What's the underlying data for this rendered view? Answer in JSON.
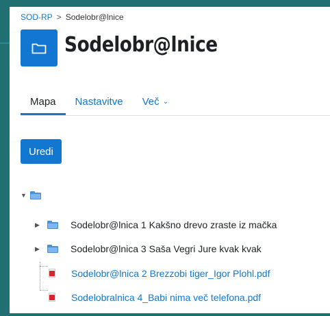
{
  "breadcrumb": {
    "root": "SOD-RP",
    "separator": ">",
    "current": "Sodelobr@lnice"
  },
  "header": {
    "title": "Sodelobr@lnice",
    "icon": "folder-icon"
  },
  "tabs": [
    {
      "label": "Mapa",
      "active": true
    },
    {
      "label": "Nastavitve",
      "active": false
    },
    {
      "label": "Več",
      "active": false,
      "dropdown": true
    }
  ],
  "actions": {
    "edit_label": "Uredi"
  },
  "tree": {
    "root": {
      "icon": "folder-icon",
      "expanded": true
    },
    "items": [
      {
        "type": "folder",
        "icon": "folder-icon",
        "expanded": false,
        "label": "Sodelobr@lnica 1 Kakšno drevo zraste iz mačka"
      },
      {
        "type": "folder",
        "icon": "folder-icon",
        "expanded": false,
        "label": "Sodelobr@lnica 3 Saša Vegri Jure kvak kvak"
      },
      {
        "type": "file",
        "icon": "pdf-icon",
        "label": "Sodelobr@lnica 2 Brezzobi tiger_Igor Plohl.pdf"
      },
      {
        "type": "file",
        "icon": "pdf-icon",
        "label": "Sodelobralnica 4_Babi nima več telefona.pdf"
      }
    ]
  },
  "colors": {
    "accent": "#1177d1",
    "frame": "#1f6f73",
    "pdf": "#d9232d"
  }
}
